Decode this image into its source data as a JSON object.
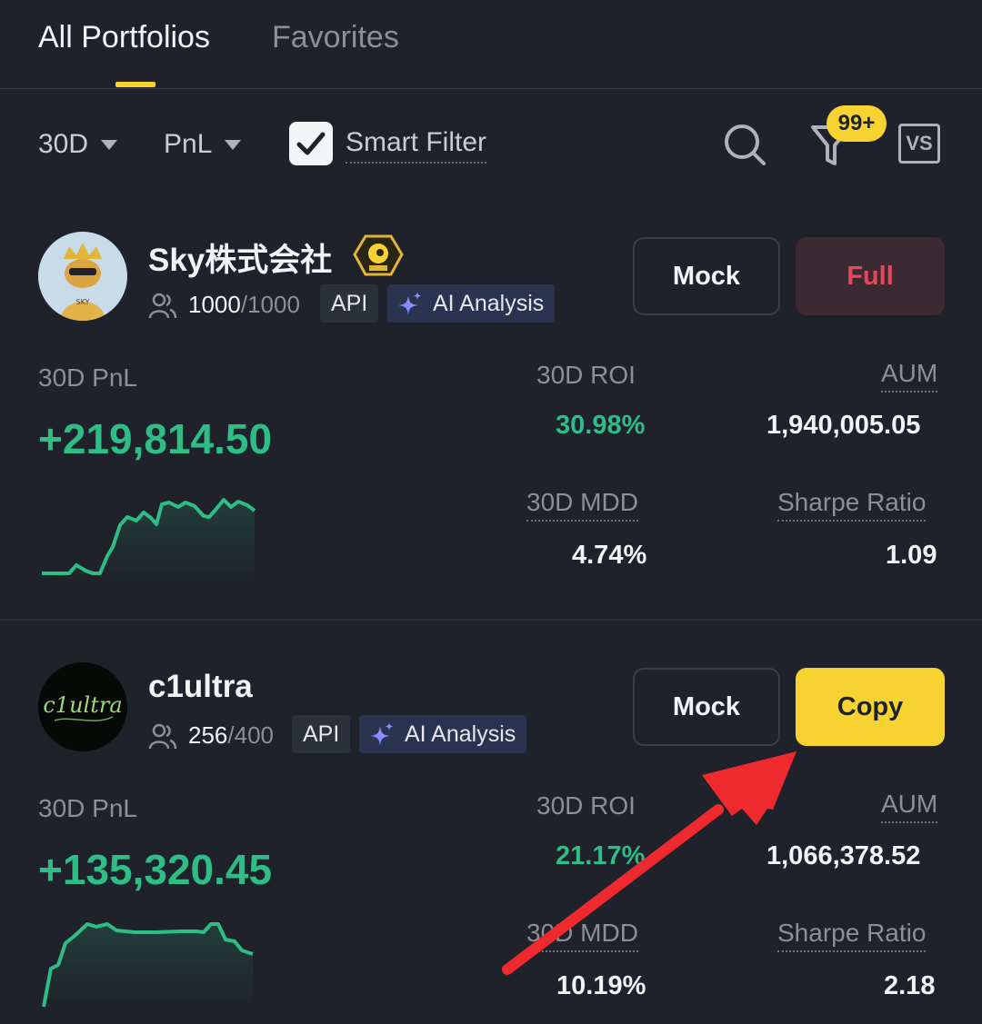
{
  "tabs": [
    {
      "label": "All Portfolios",
      "active": true
    },
    {
      "label": "Favorites",
      "active": false
    }
  ],
  "filters": {
    "period": "30D",
    "sort": "PnL",
    "smart_filter_label": "Smart Filter",
    "smart_filter_checked": true,
    "filter_badge": "99+",
    "compare_label": "VS"
  },
  "colors": {
    "accent": "#f7d331",
    "positive": "#2ebd85",
    "negative": "#e8485c",
    "background": "#1f222a"
  },
  "portfolios": [
    {
      "name": "Sky株式会社",
      "avatar_text": "SKY",
      "copiers": "1000",
      "max_copiers": "/1000",
      "api_tag": "API",
      "ai_tag": "AI Analysis",
      "mock_label": "Mock",
      "action_label": "Full",
      "pnl_label": "30D PnL",
      "pnl_value": "+219,814.50",
      "roi_label": "30D  ROI",
      "roi_value": "30.98%",
      "aum_label": "AUM",
      "aum_value": "1,940,005.05",
      "mdd_label": "30D MDD",
      "mdd_value": "4.74%",
      "sharpe_label": "Sharpe Ratio",
      "sharpe_value": "1.09"
    },
    {
      "name": "c1ultra",
      "avatar_text": "c1ultra",
      "copiers": "256",
      "max_copiers": "/400",
      "api_tag": "API",
      "ai_tag": "AI Analysis",
      "mock_label": "Mock",
      "action_label": "Copy",
      "pnl_label": "30D PnL",
      "pnl_value": "+135,320.45",
      "roi_label": "30D  ROI",
      "roi_value": "21.17%",
      "aum_label": "AUM",
      "aum_value": "1,066,378.52",
      "mdd_label": "30D MDD",
      "mdd_value": "10.19%",
      "sharpe_label": "Sharpe Ratio",
      "sharpe_value": "2.18"
    }
  ]
}
